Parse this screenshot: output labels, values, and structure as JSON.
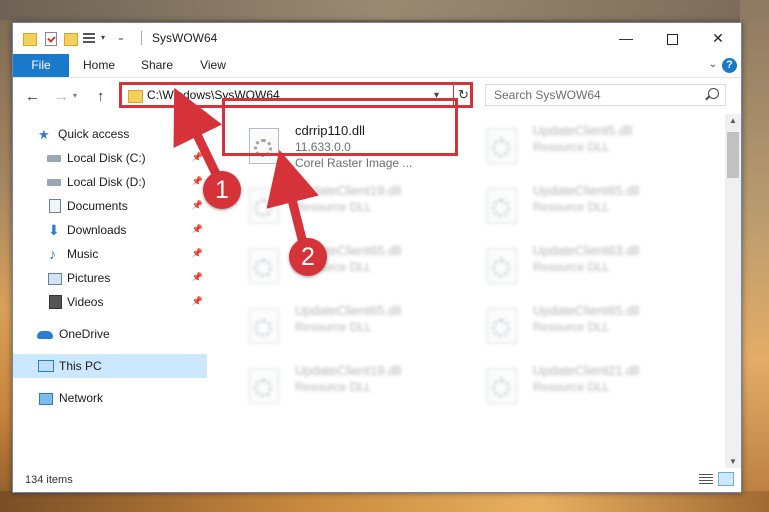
{
  "window": {
    "title": "SysWOW64",
    "quick_access_drop": "▾",
    "minimize": "—",
    "close": "✕"
  },
  "ribbon": {
    "tabs": [
      "File",
      "Home",
      "Share",
      "View"
    ],
    "help": "?"
  },
  "navigation": {
    "back": "←",
    "forward": "→",
    "history": "▾",
    "up": "↑",
    "address": "C:\\Windows\\SysWOW64",
    "address_drop": "▾",
    "refresh": "↻",
    "search_placeholder": "Search SysWOW64"
  },
  "sidebar": {
    "items": [
      {
        "label": "Quick access",
        "icon": "star-icon",
        "pinned": false
      },
      {
        "label": "Local Disk (C:)",
        "icon": "disk-icon",
        "pinned": true
      },
      {
        "label": "Local Disk (D:)",
        "icon": "disk-icon",
        "pinned": true
      },
      {
        "label": "Documents",
        "icon": "documents-icon",
        "pinned": true
      },
      {
        "label": "Downloads",
        "icon": "download-icon",
        "pinned": true
      },
      {
        "label": "Music",
        "icon": "music-icon",
        "pinned": true
      },
      {
        "label": "Pictures",
        "icon": "pictures-icon",
        "pinned": true
      },
      {
        "label": "Videos",
        "icon": "videos-icon",
        "pinned": true
      },
      {
        "label": "OneDrive",
        "icon": "onedrive-icon",
        "pinned": false
      },
      {
        "label": "This PC",
        "icon": "pc-icon",
        "pinned": false,
        "selected": true
      },
      {
        "label": "Network",
        "icon": "network-icon",
        "pinned": false
      }
    ],
    "pin_glyph": "📌"
  },
  "files": {
    "left": [
      {
        "name": "cdrrip110.dll",
        "version": "11.633.0.0",
        "desc": "Corel Raster Image ..."
      },
      {
        "name": "UpdateClient19.dll",
        "desc": "Resource DLL"
      },
      {
        "name": "UpdateClient65.dll",
        "desc": "Resource DLL"
      },
      {
        "name": "UpdateClient65.dll",
        "desc": "Resource DLL"
      },
      {
        "name": "UpdateClient19.dll",
        "desc": "Resource DLL"
      }
    ],
    "right": [
      {
        "name": "UpdateClient5.dll",
        "desc": "Resource DLL"
      },
      {
        "name": "UpdateClient65.dll",
        "desc": "Resource DLL"
      },
      {
        "name": "UpdateClient63.dll",
        "desc": "Resource DLL"
      },
      {
        "name": "UpdateClient65.dll",
        "desc": "Resource DLL"
      },
      {
        "name": "UpdateClient21.dll",
        "desc": "Resource DLL"
      }
    ]
  },
  "status": {
    "count": "134 items"
  },
  "annotations": {
    "step1": "1",
    "step2": "2",
    "color": "#d6323a"
  },
  "colors": {
    "accent": "#1979ca",
    "selection": "#cce8ff",
    "highlight": "#d6323a"
  }
}
